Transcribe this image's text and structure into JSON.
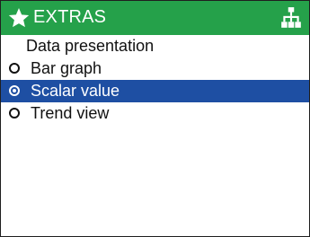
{
  "header": {
    "title": "EXTRAS",
    "left_icon": "star-icon",
    "right_icon": "tree-icon",
    "bg_color": "#25a14a"
  },
  "subtitle": "Data presentation",
  "options": [
    {
      "label": "Bar graph",
      "selected": false
    },
    {
      "label": "Scalar value",
      "selected": true
    },
    {
      "label": "Trend view",
      "selected": false
    }
  ],
  "selected_color": "#1e4fa3"
}
